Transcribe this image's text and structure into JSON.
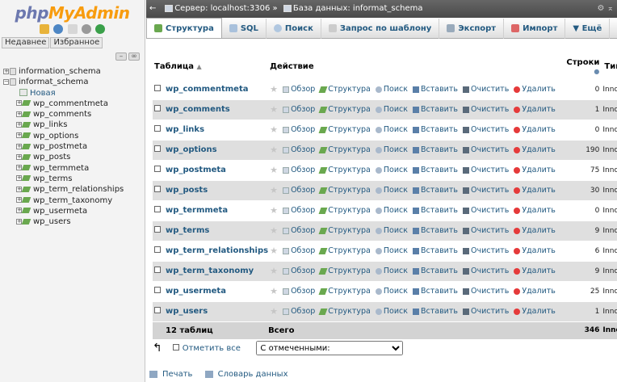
{
  "logo": {
    "part1": "php",
    "part2": "MyAdmin"
  },
  "nav": {
    "tabs": [
      "Недавнее",
      "Избранное"
    ],
    "tree": [
      {
        "label": "information_schema",
        "level": 0,
        "kind": "db"
      },
      {
        "label": "informat_schema",
        "level": 0,
        "kind": "db-open"
      },
      {
        "label": "Новая",
        "level": 1,
        "kind": "new"
      },
      {
        "label": "wp_commentmeta",
        "level": 1,
        "kind": "table"
      },
      {
        "label": "wp_comments",
        "level": 1,
        "kind": "table"
      },
      {
        "label": "wp_links",
        "level": 1,
        "kind": "table"
      },
      {
        "label": "wp_options",
        "level": 1,
        "kind": "table"
      },
      {
        "label": "wp_postmeta",
        "level": 1,
        "kind": "table"
      },
      {
        "label": "wp_posts",
        "level": 1,
        "kind": "table"
      },
      {
        "label": "wp_termmeta",
        "level": 1,
        "kind": "table"
      },
      {
        "label": "wp_terms",
        "level": 1,
        "kind": "table"
      },
      {
        "label": "wp_term_relationships",
        "level": 1,
        "kind": "table"
      },
      {
        "label": "wp_term_taxonomy",
        "level": 1,
        "kind": "table"
      },
      {
        "label": "wp_usermeta",
        "level": 1,
        "kind": "table"
      },
      {
        "label": "wp_users",
        "level": 1,
        "kind": "table"
      }
    ]
  },
  "topbar": {
    "server": "Сервер: localhost:3306",
    "separator": "»",
    "database": "База данных: informat_schema"
  },
  "menu": {
    "tabs": [
      {
        "label": "Структура",
        "icon": "structure-icon",
        "active": true
      },
      {
        "label": "SQL",
        "icon": "sql-icon"
      },
      {
        "label": "Поиск",
        "icon": "search-icon"
      },
      {
        "label": "Запрос по шаблону",
        "icon": "query-icon"
      },
      {
        "label": "Экспорт",
        "icon": "export-icon"
      },
      {
        "label": "Импорт",
        "icon": "import-icon"
      },
      {
        "label": "Ещё",
        "icon": "chevron-down-icon"
      }
    ]
  },
  "table": {
    "headers": {
      "table": "Таблица",
      "action": "Действие",
      "rows": "Строки",
      "type": "Тип"
    },
    "action_labels": {
      "browse": "Обзор",
      "structure": "Структура",
      "search": "Поиск",
      "insert": "Вставить",
      "empty": "Очистить",
      "drop": "Удалить"
    },
    "rows": [
      {
        "name": "wp_commentmeta",
        "rows": "0",
        "type": "InnoD"
      },
      {
        "name": "wp_comments",
        "rows": "1",
        "type": "InnoD"
      },
      {
        "name": "wp_links",
        "rows": "0",
        "type": "InnoD"
      },
      {
        "name": "wp_options",
        "rows": "190",
        "type": "InnoD"
      },
      {
        "name": "wp_postmeta",
        "rows": "75",
        "type": "InnoD"
      },
      {
        "name": "wp_posts",
        "rows": "30",
        "type": "InnoD"
      },
      {
        "name": "wp_termmeta",
        "rows": "0",
        "type": "InnoD"
      },
      {
        "name": "wp_terms",
        "rows": "9",
        "type": "InnoD"
      },
      {
        "name": "wp_term_relationships",
        "rows": "6",
        "type": "InnoD"
      },
      {
        "name": "wp_term_taxonomy",
        "rows": "9",
        "type": "InnoD"
      },
      {
        "name": "wp_usermeta",
        "rows": "25",
        "type": "InnoD"
      },
      {
        "name": "wp_users",
        "rows": "1",
        "type": "InnoD"
      }
    ],
    "total": {
      "label": "12 таблиц",
      "sum_label": "Всего",
      "rows": "346",
      "type": "InnoI"
    }
  },
  "bulk": {
    "check_all": "Отметить все",
    "with_selected": "С отмеченными:"
  },
  "footer": {
    "print": "Печать",
    "dictionary": "Словарь данных"
  }
}
